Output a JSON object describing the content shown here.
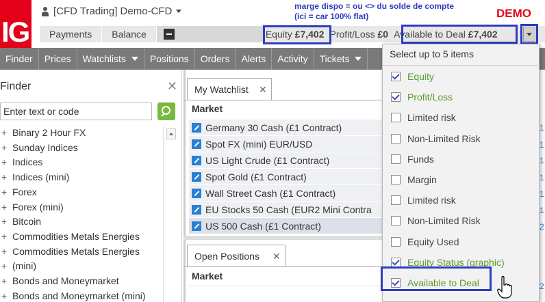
{
  "header": {
    "logo_text": "IG",
    "account_label": "[CFD Trading] Demo-CFD",
    "annotation_line1": "marge dispo = ou <> du solde de compte",
    "annotation_line2": "(ici = car 100% flat)",
    "demo_label": "DEMO"
  },
  "subbar": {
    "payments": "Payments",
    "balance": "Balance",
    "equity_label": "Equity",
    "equity_value": "£7,402",
    "pl_label": "Profit/Loss",
    "pl_value": "£0",
    "atd_label": "Available to Deal",
    "atd_value": "£7,402"
  },
  "nav": {
    "items": [
      "Finder",
      "Prices",
      "Watchlists",
      "Positions",
      "Orders",
      "Alerts",
      "Activity",
      "Tickets"
    ]
  },
  "finder": {
    "title": "Finder",
    "close": "✕",
    "search_placeholder": "Enter text or code",
    "items": [
      "Binary 2 Hour FX",
      "Sunday Indices",
      "Indices",
      "Indices (mini)",
      "Forex",
      "Forex (mini)",
      "Bitcoin",
      "Commodities Metals Energies",
      "Commodities Metals Energies",
      "(mini)",
      "Bonds and Moneymarket",
      "Bonds and Moneymarket (mini)"
    ]
  },
  "watchlist": {
    "tab": "My Watchlist",
    "close": "✕",
    "column": "Market",
    "rows": [
      "Germany 30 Cash (£1 Contract)",
      "Spot FX (mini) EUR/USD",
      "US Light Crude (£1 Contract)",
      "Spot Gold (£1 Contract)",
      "Wall Street Cash (£1 Contract)",
      "EU Stocks 50 Cash (EUR2 Mini Contra",
      "US 500 Cash (£1 Contract)"
    ]
  },
  "positions": {
    "tab": "Open Positions",
    "close": "✕",
    "column": "Market"
  },
  "dropdown": {
    "title": "Select up to 5 items",
    "items": [
      {
        "label": "Equity",
        "checked": true
      },
      {
        "label": "Profit/Loss",
        "checked": true
      },
      {
        "label": "Limited risk",
        "checked": false
      },
      {
        "label": "Non-Limited Risk",
        "checked": false
      },
      {
        "label": "Funds",
        "checked": false
      },
      {
        "label": "Margin",
        "checked": false
      },
      {
        "label": "Limited risk",
        "checked": false
      },
      {
        "label": "Non-Limited Risk",
        "checked": false
      },
      {
        "label": "Equity Used",
        "checked": false
      },
      {
        "label": "Equity Status (graphic)",
        "checked": true
      },
      {
        "label": "Available to Deal",
        "checked": true
      }
    ]
  },
  "right_edge": {
    "marks": [
      "1",
      "1",
      "1",
      "1",
      "1",
      "1",
      "2",
      "2"
    ]
  },
  "colors": {
    "brand_red": "#e2001a",
    "annotation_blue": "#2f3bc0",
    "nav_gray": "#7a7a7a",
    "checked_green": "#5a9a2a"
  }
}
